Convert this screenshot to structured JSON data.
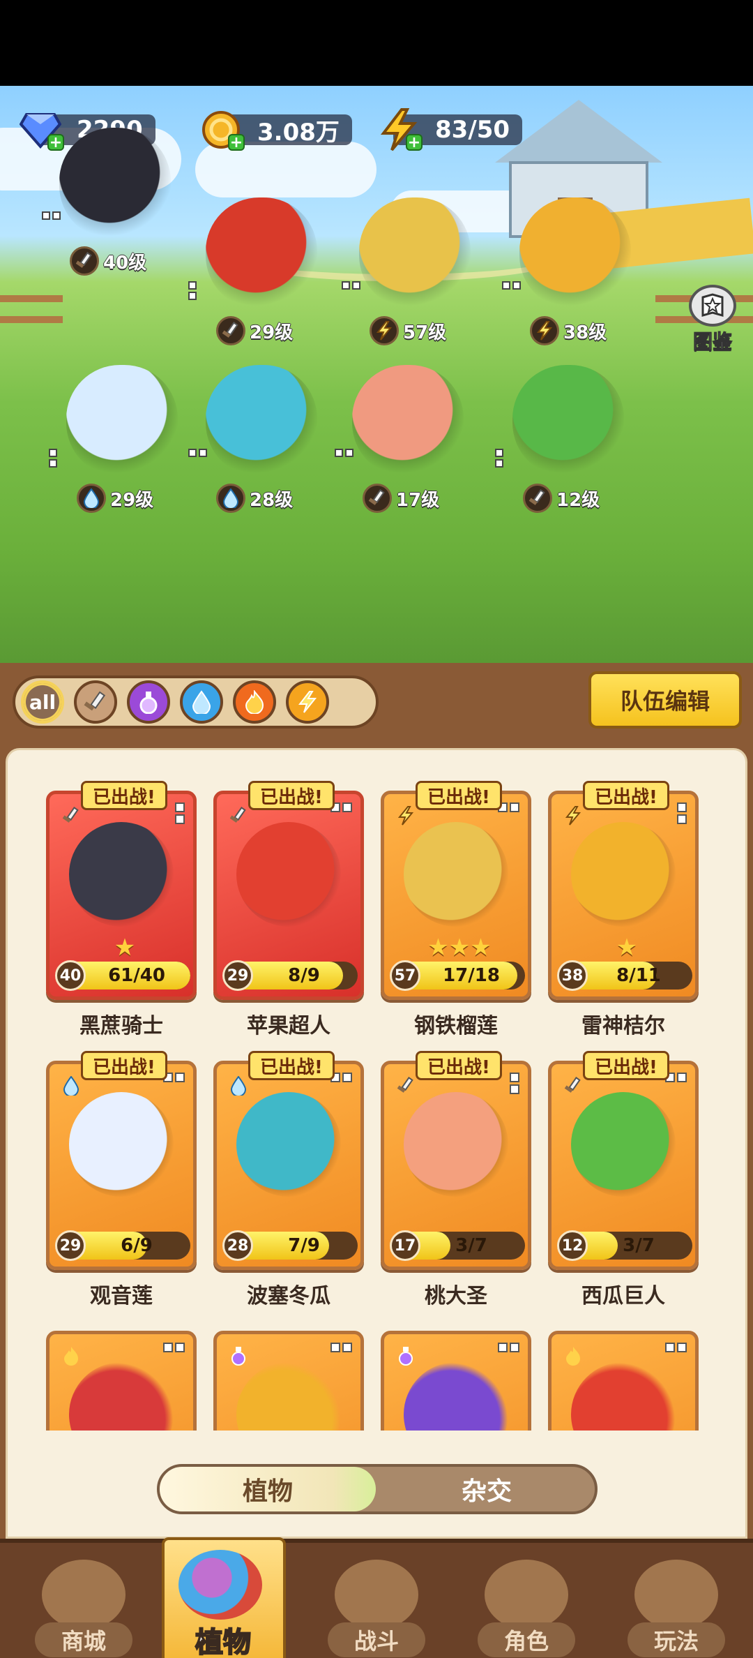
{
  "resources": {
    "gems": "2290",
    "coins": "3.08万",
    "energy": "83/50"
  },
  "codex_label": "图鉴",
  "lineup": [
    {
      "level": "40级",
      "element": "sword"
    },
    {
      "level": "29级",
      "element": "sword"
    },
    {
      "level": "57级",
      "element": "lightning"
    },
    {
      "level": "38级",
      "element": "lightning"
    },
    {
      "level": "29级",
      "element": "water"
    },
    {
      "level": "28级",
      "element": "water"
    },
    {
      "level": "17级",
      "element": "sword"
    },
    {
      "level": "12级",
      "element": "sword"
    }
  ],
  "filters": {
    "all_label": "all",
    "items": [
      "sword-icon",
      "potion-icon",
      "water-icon",
      "fire-icon",
      "lightning-icon"
    ]
  },
  "team_edit_label": "队伍编辑",
  "deployed_label": "已出战!",
  "plants": [
    {
      "name": "黑蔗骑士",
      "level": "40",
      "progress": "61/40",
      "fill": 1.0,
      "element": "sword",
      "red": true
    },
    {
      "name": "苹果超人",
      "level": "29",
      "progress": "8/9",
      "fill": 0.89,
      "element": "sword",
      "red": true
    },
    {
      "name": "钢铁榴莲",
      "level": "57",
      "progress": "17/18",
      "fill": 0.94,
      "element": "lightning",
      "red": false
    },
    {
      "name": "雷神桔尔",
      "level": "38",
      "progress": "8/11",
      "fill": 0.73,
      "element": "lightning",
      "red": false
    },
    {
      "name": "观音莲",
      "level": "29",
      "progress": "6/9",
      "fill": 0.67,
      "element": "water",
      "red": false
    },
    {
      "name": "波塞冬瓜",
      "level": "28",
      "progress": "7/9",
      "fill": 0.78,
      "element": "water",
      "red": false
    },
    {
      "name": "桃大圣",
      "level": "17",
      "progress": "3/7",
      "fill": 0.43,
      "element": "sword",
      "red": false
    },
    {
      "name": "西瓜巨人",
      "level": "12",
      "progress": "3/7",
      "fill": 0.43,
      "element": "sword",
      "red": false
    }
  ],
  "tabs": {
    "plants": "植物",
    "hybrid": "杂交"
  },
  "nav": {
    "shop": "商城",
    "plants": "植物",
    "battle": "战斗",
    "character": "角色",
    "gameplay": "玩法"
  },
  "colors": {
    "accent": "#f5c21e",
    "panel_bg": "#f8f0de",
    "wood": "#8a5a36"
  }
}
